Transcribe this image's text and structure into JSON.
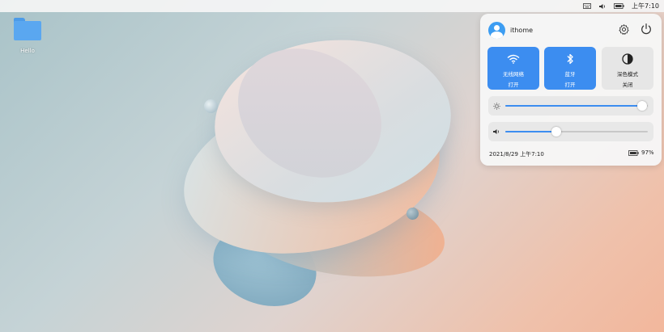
{
  "topbar": {
    "clock": "上午7:10",
    "icons": [
      "keyboard-icon",
      "volume-icon",
      "battery-icon"
    ]
  },
  "desktop": {
    "icons": [
      {
        "label": "Hello",
        "icon": "folder-icon"
      }
    ]
  },
  "panel": {
    "username": "ithome",
    "tiles": [
      {
        "name": "无线网络",
        "state": "打开",
        "icon": "wifi-icon",
        "active": true
      },
      {
        "name": "蓝牙",
        "state": "打开",
        "icon": "bluetooth-icon",
        "active": true
      },
      {
        "name": "深色模式",
        "state": "关闭",
        "icon": "dark-mode-icon",
        "active": false
      }
    ],
    "brightness": {
      "icon": "brightness-icon",
      "value": 0.96
    },
    "volume": {
      "icon": "volume-icon",
      "value": 0.36
    },
    "footer": {
      "datetime": "2021/8/29 上午7:10",
      "battery": "97%"
    }
  },
  "colors": {
    "accent": "#3c8df0",
    "folder": "#5aa7f0"
  }
}
